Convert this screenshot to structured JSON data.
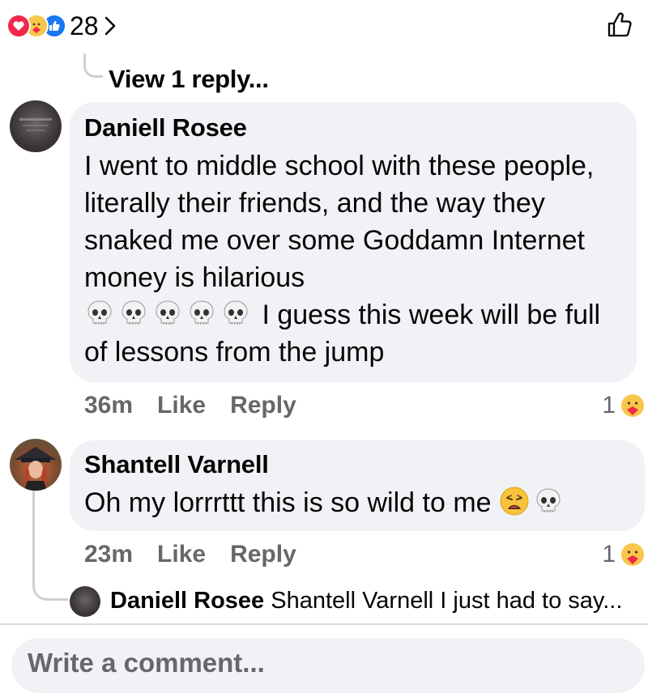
{
  "reactions": {
    "count": "28",
    "types": [
      "love-icon",
      "care-icon",
      "like-icon"
    ],
    "colors": {
      "love": "#f0284a",
      "care": "#f7c64b",
      "like": "#1877f2"
    }
  },
  "thread": {
    "view_replies_label": "View 1 reply..."
  },
  "comments": [
    {
      "author": "Daniell Rosee",
      "line1": "I went to middle school with these people, literally their friends, and the way they snaked me over some Goddamn Internet money is hilarious",
      "emojis": [
        "skull-emoji",
        "skull-emoji",
        "skull-emoji",
        "skull-emoji",
        "skull-emoji"
      ],
      "line2": "I guess this week will be full of lessons from the jump",
      "time": "36m",
      "like_label": "Like",
      "reply_label": "Reply",
      "reaction_count": "1",
      "reaction_icon": "care-icon"
    },
    {
      "author": "Shantell Varnell",
      "text": "Oh my lorrrttt this is so wild to me",
      "emojis": [
        "weary-face-emoji",
        "skull-emoji"
      ],
      "time": "23m",
      "like_label": "Like",
      "reply_label": "Reply",
      "reaction_count": "1",
      "reaction_icon": "care-icon"
    }
  ],
  "nested_reply": {
    "author": "Daniell Rosee",
    "preview": "Shantell Varnell I just had to say..."
  },
  "composer": {
    "placeholder": "Write a comment..."
  }
}
